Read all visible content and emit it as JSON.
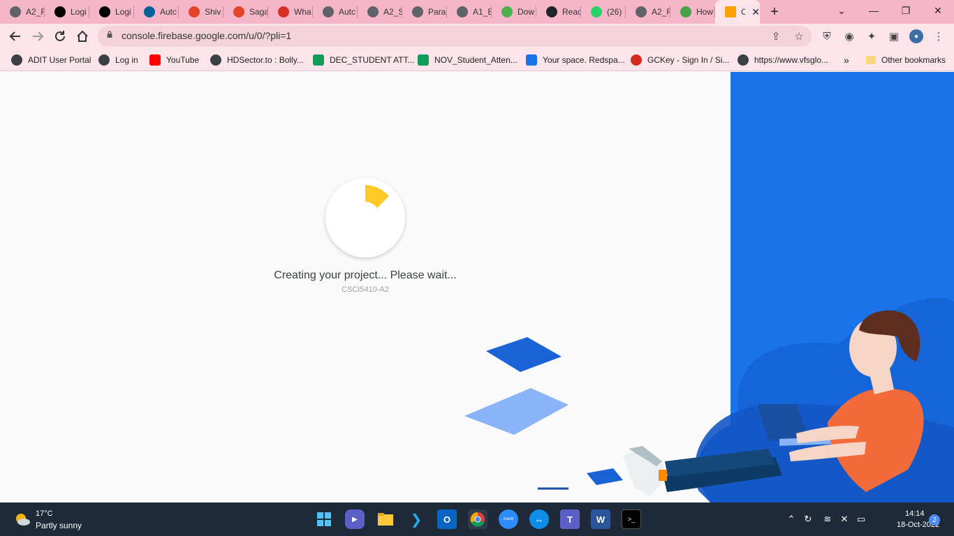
{
  "tabs": [
    {
      "title": "A2_F",
      "icon": "globe-icon",
      "color": "#5f6368"
    },
    {
      "title": "Logi",
      "icon": "d2l-icon",
      "color": "#000000"
    },
    {
      "title": "Logi",
      "icon": "d2l-icon",
      "color": "#000000"
    },
    {
      "title": "Autc",
      "icon": "ieee-icon",
      "color": "#00629b"
    },
    {
      "title": "Shiv",
      "icon": "gitlab-icon",
      "color": "#e24329"
    },
    {
      "title": "Saga",
      "icon": "gitlab-icon",
      "color": "#e24329"
    },
    {
      "title": "Wha",
      "icon": "alert-icon",
      "color": "#d93025"
    },
    {
      "title": "Autc",
      "icon": "globe-icon",
      "color": "#5f6368"
    },
    {
      "title": "A2_S",
      "icon": "globe-icon",
      "color": "#5f6368"
    },
    {
      "title": "Para",
      "icon": "feather-icon",
      "color": "#5f6368"
    },
    {
      "title": "A1_E",
      "icon": "globe-icon",
      "color": "#5f6368"
    },
    {
      "title": "Dow",
      "icon": "cube-icon",
      "color": "#4caf50"
    },
    {
      "title": "Reac",
      "icon": "react-icon",
      "color": "#20232a"
    },
    {
      "title": "(26)",
      "icon": "whatsapp-icon",
      "color": "#25d366"
    },
    {
      "title": "A2_F",
      "icon": "globe-icon",
      "color": "#5f6368"
    },
    {
      "title": "How",
      "icon": "mongodb-icon",
      "color": "#47a248"
    }
  ],
  "active_tab": {
    "title": "C",
    "icon": "firebase-icon",
    "color": "#ffa000"
  },
  "address_bar": {
    "url": "console.firebase.google.com/u/0/?pli=1"
  },
  "bookmarks": [
    {
      "label": "ADIT User Portal",
      "icon": "globe-icon",
      "color": "#3c4043"
    },
    {
      "label": "Log in",
      "icon": "globe-icon",
      "color": "#3c4043"
    },
    {
      "label": "YouTube",
      "icon": "youtube-icon",
      "color": "#ff0000"
    },
    {
      "label": "HDSector.to : Bolly...",
      "icon": "globe-icon",
      "color": "#3c4043"
    },
    {
      "label": "DEC_STUDENT ATT...",
      "icon": "sheets-icon",
      "color": "#0f9d58"
    },
    {
      "label": "NOV_Student_Atten...",
      "icon": "sheets-icon",
      "color": "#0f9d58"
    },
    {
      "label": "Your space. Redspa...",
      "icon": "puzzle-icon",
      "color": "#1a73e8"
    },
    {
      "label": "GCKey - Sign In / Si...",
      "icon": "maple-leaf-icon",
      "color": "#d52b1e"
    },
    {
      "label": "https://www.vfsglo...",
      "icon": "globe-icon",
      "color": "#3c4043"
    }
  ],
  "bookmarks_overflow": "»",
  "other_bookmarks": "Other bookmarks",
  "page": {
    "status": "Creating your project... Please wait...",
    "project_id": "CSCI5410-A2",
    "accent": "#1a73e8",
    "spinner_color": "#ffca28"
  },
  "taskbar": {
    "weather_temp": "17°C",
    "weather_desc": "Partly sunny",
    "time": "14:14",
    "date": "18-Oct-2022",
    "notifications": "2",
    "zoom_label": "zoom"
  },
  "window": {
    "minimize": "—",
    "maximize": "❐",
    "close": "✕",
    "chevron": "⌄",
    "new_tab": "+"
  }
}
